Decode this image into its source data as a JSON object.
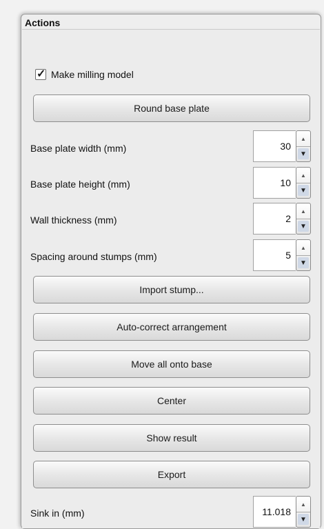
{
  "panel": {
    "title": "Actions"
  },
  "milling": {
    "checked": true,
    "label": "Make milling model"
  },
  "buttons": {
    "round_base_plate": "Round base plate",
    "import_stump": "Import stump...",
    "auto_correct": "Auto-correct arrangement",
    "move_all": "Move all onto base",
    "center": "Center",
    "show_result": "Show result",
    "export": "Export"
  },
  "fields": {
    "base_plate_width": {
      "label": "Base plate width (mm)",
      "value": "30"
    },
    "base_plate_height": {
      "label": "Base plate height (mm)",
      "value": "10"
    },
    "wall_thickness": {
      "label": "Wall thickness (mm)",
      "value": "2"
    },
    "spacing": {
      "label": "Spacing around stumps (mm)",
      "value": "5"
    },
    "sink_in": {
      "label": "Sink in (mm)",
      "value": "11.018"
    }
  },
  "icons": {
    "check": "✓",
    "up": "▲",
    "down": "▼"
  }
}
